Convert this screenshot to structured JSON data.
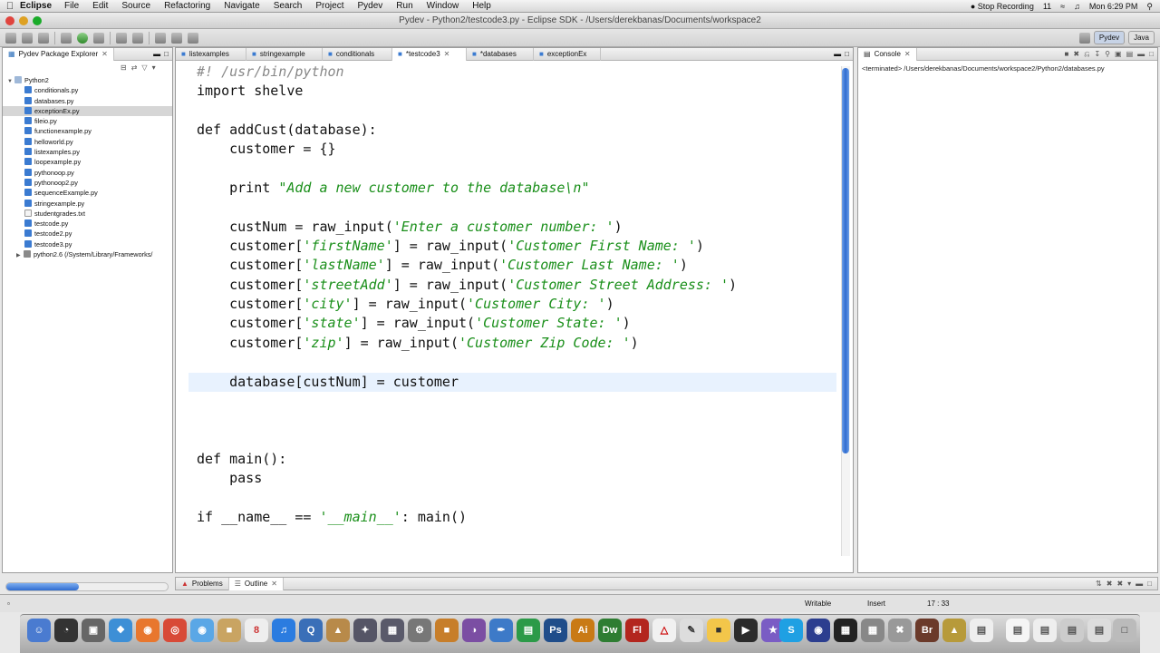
{
  "menubar": {
    "app": "Eclipse",
    "items": [
      "File",
      "Edit",
      "Source",
      "Refactoring",
      "Navigate",
      "Search",
      "Project",
      "Pydev",
      "Run",
      "Window",
      "Help"
    ],
    "stop_recording": "Stop Recording",
    "battery_count": "11",
    "clock": "Mon 6:29 PM"
  },
  "window": {
    "title": "Pydev - Python2/testcode3.py - Eclipse SDK - /Users/derekbanas/Documents/workspace2"
  },
  "perspectives": [
    {
      "label": "Pydev",
      "active": true
    },
    {
      "label": "Java",
      "active": false
    }
  ],
  "explorer": {
    "title": "Pydev Package Explorer",
    "project": "Python2",
    "files": [
      "conditionals.py",
      "databases.py",
      "exceptionEx.py",
      "fileio.py",
      "functionexample.py",
      "helloworld.py",
      "listexamples.py",
      "loopexample.py",
      "pythonoop.py",
      "pythonoop2.py",
      "sequenceExample.py",
      "stringexample.py",
      "studentgrades.txt",
      "testcode.py",
      "testcode2.py",
      "testcode3.py"
    ],
    "selected": "exceptionEx.py",
    "library": "python2.6  (/System/Library/Frameworks/"
  },
  "editor": {
    "tabs": [
      "listexamples",
      "stringexample",
      "conditionals",
      "*testcode3",
      "*databases",
      "exceptionEx"
    ],
    "active_tab": "*testcode3",
    "code": {
      "l1": "#! /usr/bin/python",
      "l2": "import shelve",
      "l4a": "def ",
      "l4b": "addCust(database):",
      "l5": "    customer = {}",
      "l7a": "    print ",
      "l7b": "\"Add a new customer to the database\\n\"",
      "l9a": "    custNum = raw_input(",
      "l9b": "'Enter a customer number: '",
      "l9c": ")",
      "l10a": "    customer[",
      "l10b": "'firstName'",
      "l10c": "] = raw_input(",
      "l10d": "'Customer First Name: '",
      "l10e": ")",
      "l11a": "    customer[",
      "l11b": "'lastName'",
      "l11c": "] = raw_input(",
      "l11d": "'Customer Last Name: '",
      "l11e": ")",
      "l12a": "    customer[",
      "l12b": "'streetAdd'",
      "l12c": "] = raw_input(",
      "l12d": "'Customer Street Address: '",
      "l12e": ")",
      "l13a": "    customer[",
      "l13b": "'city'",
      "l13c": "] = raw_input(",
      "l13d": "'Customer City: '",
      "l13e": ")",
      "l14a": "    customer[",
      "l14b": "'state'",
      "l14c": "] = raw_input(",
      "l14d": "'Customer State: '",
      "l14e": ")",
      "l15a": "    customer[",
      "l15b": "'zip'",
      "l15c": "] = raw_input(",
      "l15d": "'Customer Zip Code: '",
      "l15e": ")",
      "l17": "    database[custNum] = customer",
      "l21a": "def ",
      "l21b": "main():",
      "l22": "    pass",
      "l24a": "if __name__ == ",
      "l24b": "'__main__'",
      "l24c": ": main()"
    }
  },
  "console": {
    "title": "Console",
    "text": "<terminated> /Users/derekbanas/Documents/workspace2/Python2/databases.py"
  },
  "bottom": {
    "tabs": [
      "Problems",
      "Outline"
    ]
  },
  "status": {
    "writable": "Writable",
    "mode": "Insert",
    "position": "17 : 33"
  },
  "dock": {
    "labels": [
      "Ps",
      "Ai",
      "Dw",
      "Fl",
      "Br"
    ]
  },
  "colors": {
    "string": "#1a8f1a",
    "comment": "#888888",
    "current_line": "#e8f2fe",
    "scrollbar": "#2f6cd0"
  }
}
